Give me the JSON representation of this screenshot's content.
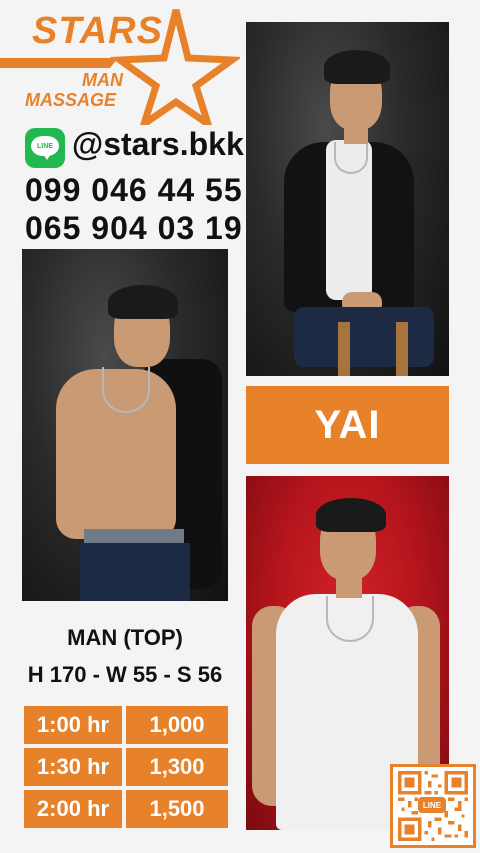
{
  "brand": {
    "line1": "STARS",
    "line2": "MAN",
    "line3": "MASSAGE",
    "color": "#e8822a"
  },
  "contact": {
    "line_icon_text": "LINE",
    "line_handle": "@stars.bkk",
    "phones": [
      "099 046 44 55",
      "065 904 03 19"
    ]
  },
  "profile": {
    "name": "YAI",
    "role": "MAN (TOP)",
    "stats": "H 170 - W 55 - S 56"
  },
  "prices": [
    {
      "duration": "1:00 hr",
      "price": "1,000"
    },
    {
      "duration": "1:30 hr",
      "price": "1,300"
    },
    {
      "duration": "2:00 hr",
      "price": "1,500"
    }
  ],
  "qr": {
    "label": "LINE"
  },
  "icons": [
    "line-app-icon",
    "star-logo-icon",
    "qr-code-icon"
  ]
}
